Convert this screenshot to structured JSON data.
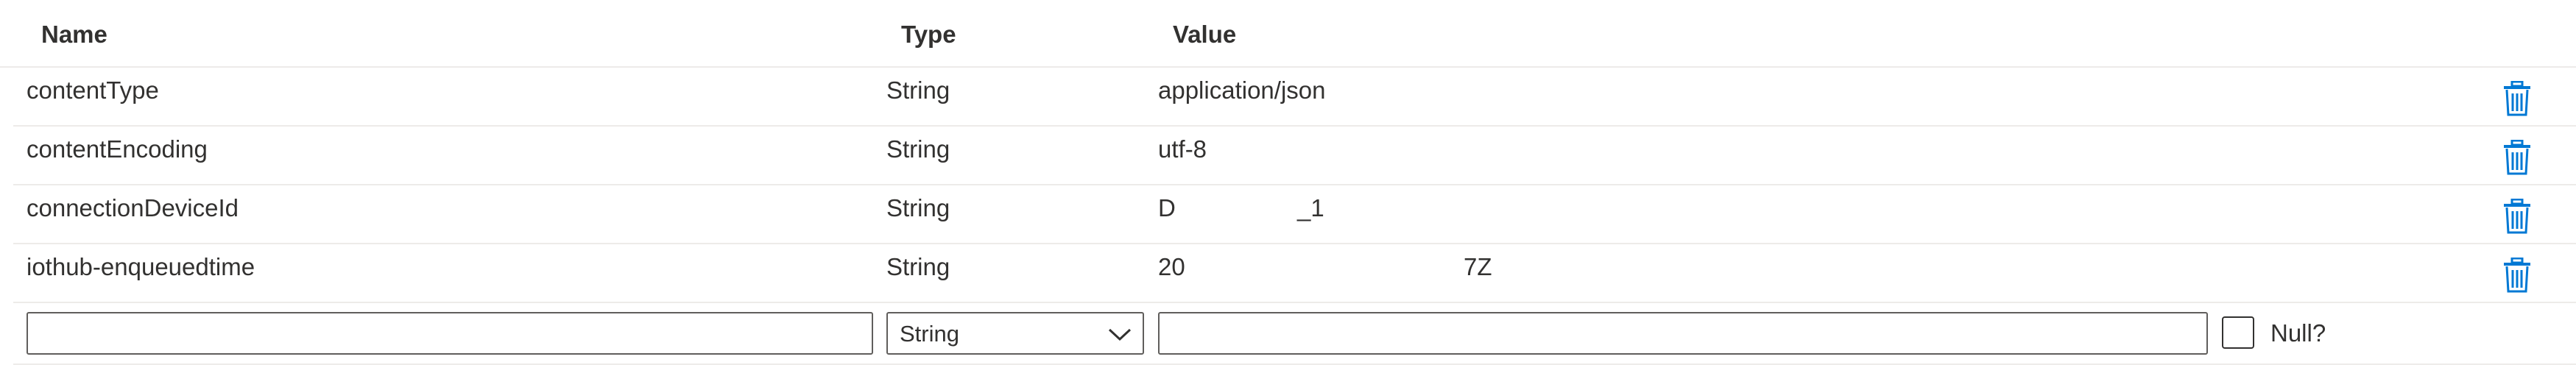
{
  "table": {
    "columns": {
      "name": "Name",
      "type": "Type",
      "value": "Value"
    },
    "rows": [
      {
        "name": "contentType",
        "type": "String",
        "value": "application/json"
      },
      {
        "name": "contentEncoding",
        "type": "String",
        "value": "utf-8"
      },
      {
        "name": "connectionDeviceId",
        "type": "String",
        "value_start": "D",
        "value_end": "_1"
      },
      {
        "name": "iothub-enqueuedtime",
        "type": "String",
        "value_start": "20",
        "value_end": "7Z"
      }
    ],
    "delete_icon": "trash-icon"
  },
  "new_property": {
    "name_value": "",
    "type_selected": "String",
    "value_value": "",
    "null_label": "Null?",
    "null_checked": false
  },
  "colors": {
    "accent": "#0078d4",
    "text": "#323130",
    "divider": "#edebe9",
    "border": "#605e5c"
  }
}
